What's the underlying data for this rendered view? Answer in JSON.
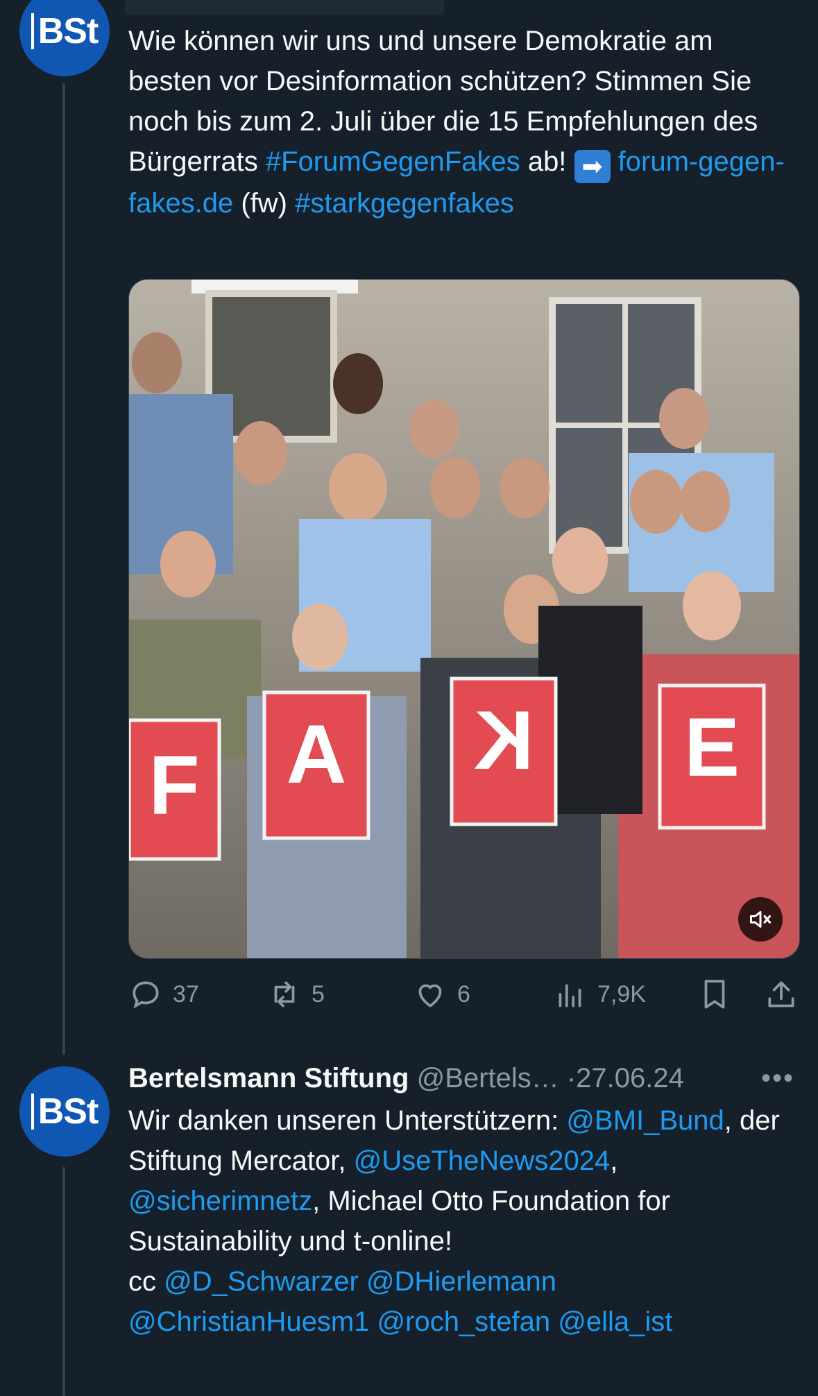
{
  "colors": {
    "background": "#15202b",
    "text": "#f7f9f9",
    "link": "#1d9bf0",
    "muted": "#8b98a5",
    "avatar": "#1057b4"
  },
  "tweet1": {
    "avatar_text": "BSt",
    "text_segments": [
      {
        "t": "Wie können wir uns und unsere Demokratie am besten vor Desinformation schützen? Stimmen Sie noch bis zum 2. Juli über die 15 Empfehlungen des Bürgerrats ",
        "link": false
      },
      {
        "t": "#ForumGegenFakes",
        "link": true
      },
      {
        "t": " ab! ",
        "link": false
      },
      {
        "t": "➡",
        "link": false,
        "emoji": true
      },
      {
        "t": " ",
        "link": false
      },
      {
        "t": "forum-gegen-fakes.de",
        "link": true
      },
      {
        "t": " (fw) ",
        "link": false
      },
      {
        "t": "#starkgegenfakes",
        "link": true
      }
    ],
    "media": {
      "sign_letters": [
        "F",
        "A",
        "K",
        "E"
      ],
      "mute_icon": "speaker-muted-icon"
    },
    "actions": {
      "reply_count": "37",
      "retweet_count": "5",
      "like_count": "6",
      "views_count": "7,9K"
    }
  },
  "tweet2": {
    "avatar_text": "BSt",
    "name": "Bertelsmann Stiftung",
    "handle": "@Bertels…",
    "separator": "·",
    "date": "27.06.24",
    "more": "•••",
    "text_segments": [
      {
        "t": "Wir danken unseren Unterstützern: ",
        "link": false
      },
      {
        "t": "@BMI_Bund",
        "link": true
      },
      {
        "t": ", der Stiftung Mercator, ",
        "link": false
      },
      {
        "t": "@UseTheNews2024",
        "link": true
      },
      {
        "t": ", ",
        "link": false
      },
      {
        "t": "@sicherimnetz",
        "link": true
      },
      {
        "t": ", Michael Otto Foundation for Sustainability und t-online!",
        "link": false
      },
      {
        "t": "\ncc ",
        "link": false
      },
      {
        "t": "@D_Schwarzer",
        "link": true
      },
      {
        "t": " ",
        "link": false
      },
      {
        "t": "@DHierlemann",
        "link": true
      },
      {
        "t": " ",
        "link": false
      },
      {
        "t": "@ChristianHuesm1",
        "link": true
      },
      {
        "t": " ",
        "link": false
      },
      {
        "t": "@roch_stefan",
        "link": true
      },
      {
        "t": " ",
        "link": false
      },
      {
        "t": "@ella_ist",
        "link": true
      }
    ]
  }
}
